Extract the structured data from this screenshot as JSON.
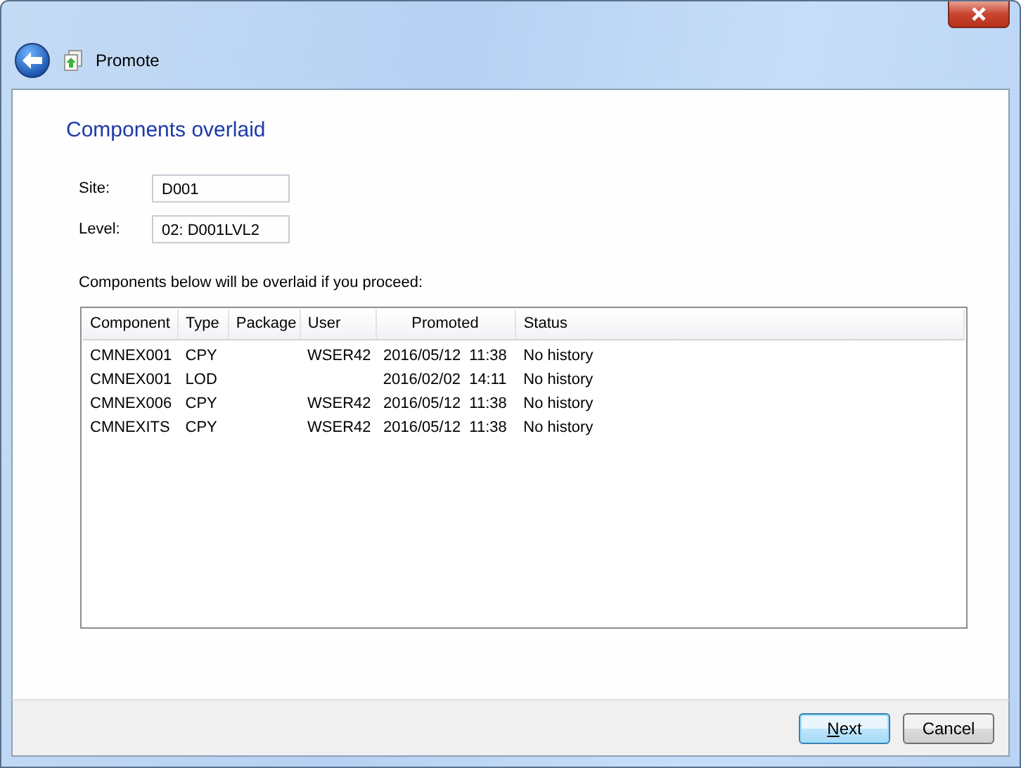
{
  "window": {
    "title": "Promote"
  },
  "page": {
    "heading": "Components overlaid",
    "fields": [
      {
        "label": "Site:",
        "value": "D001"
      },
      {
        "label": "Level:",
        "value": "02: D001LVL2"
      }
    ],
    "note": "Components below will be overlaid if you proceed:"
  },
  "table": {
    "columns": [
      "Component",
      "Type",
      "Package",
      "User",
      "Promoted",
      "Status"
    ],
    "rows": [
      [
        "CMNEX001",
        "CPY",
        "",
        "WSER42",
        "2016/05/12  11:38",
        "No history"
      ],
      [
        "CMNEX001",
        "LOD",
        "",
        "",
        "2016/02/02  14:11",
        "No history"
      ],
      [
        "CMNEX006",
        "CPY",
        "",
        "WSER42",
        "2016/05/12  11:38",
        "No history"
      ],
      [
        "CMNEXITS",
        "CPY",
        "",
        "WSER42",
        "2016/05/12  11:38",
        "No history"
      ]
    ]
  },
  "buttons": [
    {
      "label": "Next",
      "default": true,
      "access_key": true
    },
    {
      "label": "Cancel",
      "default": false
    }
  ]
}
